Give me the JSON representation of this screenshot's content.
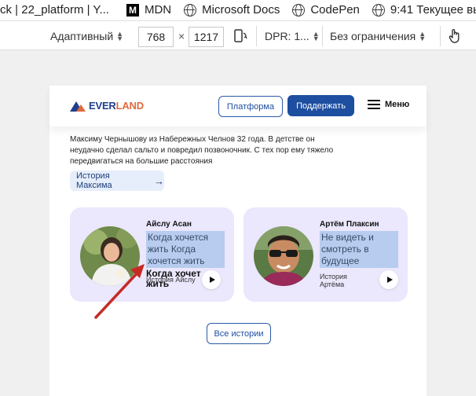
{
  "bookmarks": [
    {
      "label": "ck | 22_platform | Y...",
      "icon": "none"
    },
    {
      "label": "MDN",
      "icon": "mdn-icon"
    },
    {
      "label": "Microsoft Docs",
      "icon": "globe-icon"
    },
    {
      "label": "CodePen",
      "icon": "globe-icon"
    },
    {
      "label": "9:41  Текущее вь",
      "icon": "globe-icon"
    }
  ],
  "devtools": {
    "device_mode": "Адаптивный",
    "width": "768",
    "times": "×",
    "height": "1217",
    "dpr": "DPR: 1...",
    "throttle": "Без ограничения"
  },
  "site": {
    "logo_ever": "EVER",
    "logo_land": "LAND",
    "platform_button": "Платформа",
    "support_button": "Поддержать",
    "menu_label": "Меню",
    "story_text": "Максиму Чернышову из Набережных Челнов 32 года. В детстве он неудачно сделал сальто и повредил позвоночник. С тех пор ему тяжело передвигаться на большие расстояния",
    "story_button": "История Максима",
    "cards": [
      {
        "name": "Айслу Асан",
        "quote": "Когда хочется жить Когда хочется жить",
        "overlap_title": "Когда хочет жить",
        "subtitle": "История Айслу"
      },
      {
        "name": "Артём Плаксин",
        "quote": "Не видеть и смотреть в будущее",
        "subtitle_line1": "История",
        "subtitle_line2": "Артёма"
      }
    ],
    "all_stories_button": "Все истории"
  },
  "colors": {
    "brand_blue": "#1d4ea0",
    "brand_orange": "#e06a3d",
    "card_bg": "#ebe7fd",
    "annotation_arrow": "#d0302a"
  }
}
